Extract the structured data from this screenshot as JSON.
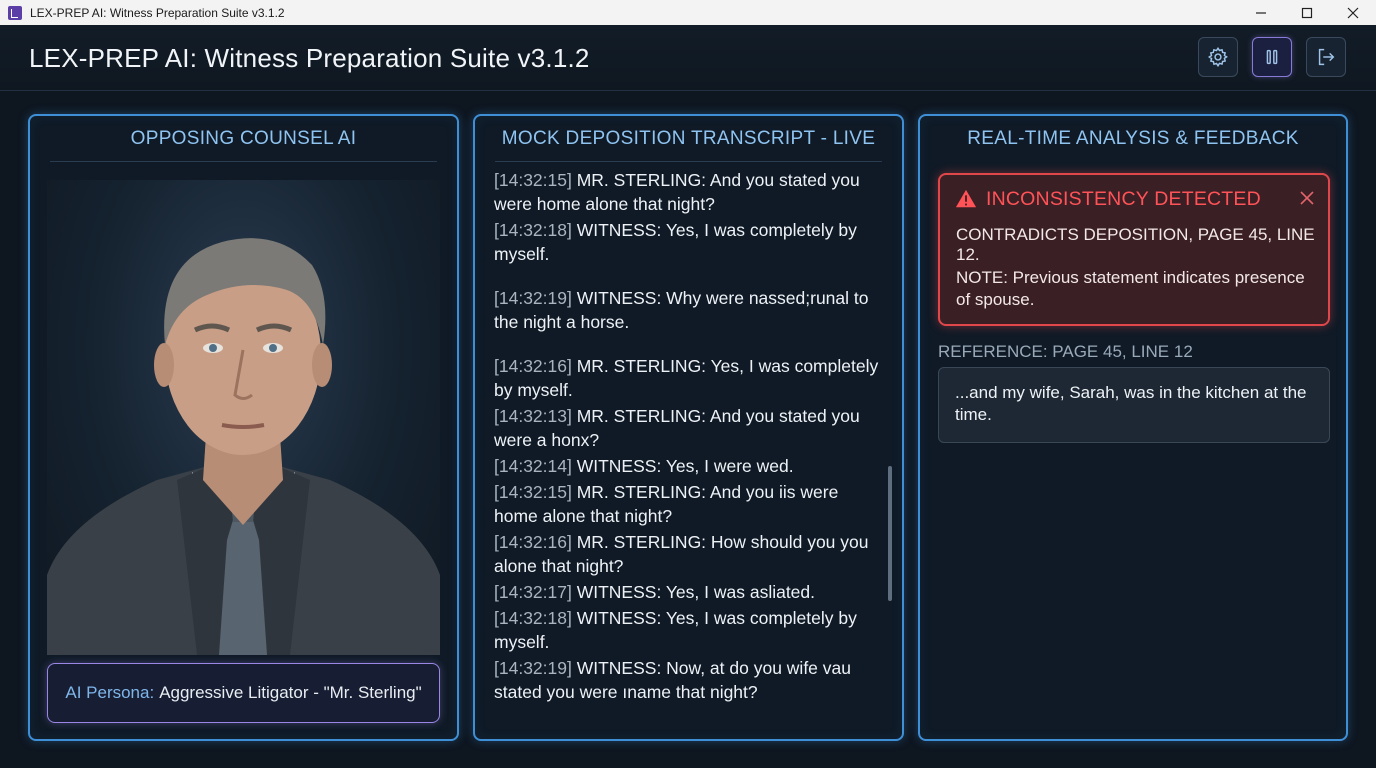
{
  "window": {
    "os_title": "LEX-PREP AI: Witness Preparation Suite v3.1.2"
  },
  "header": {
    "title": "LEX-PREP AI: Witness Preparation Suite v3.1.2",
    "buttons": [
      "gear-icon",
      "pause-icon",
      "exit-icon"
    ]
  },
  "left_panel": {
    "title": "OPPOSING COUNSEL AI",
    "persona_label": "AI Persona:",
    "persona_value": "Aggressive Litigator - \"Mr. Sterling\""
  },
  "middle_panel": {
    "title": "MOCK DEPOSITION TRANSCRIPT - LIVE",
    "lines": [
      {
        "ts": "[14:32:15]",
        "text": " MR. STERLING: And you stated you were home alone that night?"
      },
      {
        "ts": "[14:32:18]",
        "text": " WITNESS: Yes, I was completely by myself."
      },
      {
        "ts": "[14:32:19]",
        "text": " WITNESS: Why were nassed;runal to the night a horse."
      },
      {
        "ts": "[14:32:16]",
        "text": " MR. STERLING: Yes, I was completely by myself."
      },
      {
        "ts": "[14:32:13]",
        "text": " MR. STERLING: And you stated you were a honx?"
      },
      {
        "ts": "[14:32:14]",
        "text": " WITNESS: Yes, I were wed."
      },
      {
        "ts": "[14:32:15]",
        "text": " MR. STERLING: And you iis were home alone that night?"
      },
      {
        "ts": "[14:32:16]",
        "text": " MR. STERLING: How should you you alone that night?"
      },
      {
        "ts": "[14:32:17]",
        "text": " WITNESS: Yes, I was asliated."
      },
      {
        "ts": "[14:32:18]",
        "text": " WITNESS: Yes, I was completely by myself."
      },
      {
        "ts": "[14:32:19]",
        "text": " WITNESS: Now, at do you wife vau stated you were ıname that night?"
      }
    ]
  },
  "right_panel": {
    "title": "REAL-TIME ANALYSIS & FEEDBACK",
    "alert": {
      "title": "INCONSISTENCY DETECTED",
      "line1": "CONTRADICTS DEPOSITION, PAGE 45, LINE 12.",
      "line2": "NOTE: Previous statement indicates presence of spouse."
    },
    "reference_label": "REFERENCE: PAGE 45, LINE 12",
    "reference_text": "...and my wife, Sarah, was in the kitchen at the time."
  },
  "colors": {
    "panel_border": "#3f8fd6",
    "alert_red": "#e0474a",
    "persona_border": "#9b86e6",
    "background": "#0e1620"
  }
}
